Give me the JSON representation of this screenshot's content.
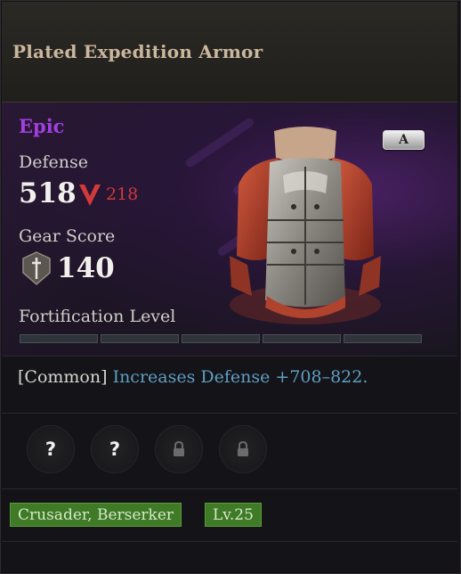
{
  "item": {
    "name": "Plated Expedition Armor",
    "rarity": "Epic",
    "grade_badge": "A",
    "defense_label": "Defense",
    "defense_value": "518",
    "defense_diff": "218",
    "gear_score_label": "Gear Score",
    "gear_score_value": "140",
    "fortification_label": "Fortification Level",
    "fortification_level": 0,
    "fortification_max": 5,
    "trait_tag": "[Common]",
    "trait_text": "Increases Defense +708–822.",
    "sockets": [
      "unknown",
      "unknown",
      "locked",
      "locked"
    ],
    "classes_tag": "Crusader, Berserker",
    "level_tag": "Lv.25"
  },
  "colors": {
    "rarity": "#a23fe0",
    "decrease": "#d23a3a",
    "stat_value": "#5f9fc4",
    "tag_bg": "#3f7a26"
  },
  "icons": {
    "defense_change": "arrow-down-icon",
    "gear_score": "sword-shield-icon",
    "socket_unknown": "question-icon",
    "socket_locked": "lock-icon"
  }
}
